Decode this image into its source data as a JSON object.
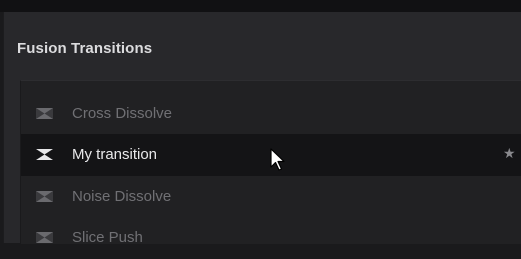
{
  "panel": {
    "title": "Fusion Transitions"
  },
  "transitions": [
    {
      "label": "Cross Dissolve",
      "selected": false
    },
    {
      "label": "My transition",
      "selected": true,
      "favorite_icon": "star-icon"
    },
    {
      "label": "Noise Dissolve",
      "selected": false
    },
    {
      "label": "Slice Push",
      "selected": false
    }
  ],
  "icons": {
    "transition": "transition-icon",
    "cursor": "pointer-cursor-icon"
  },
  "colors": {
    "panel_bg": "#28282b",
    "list_bg": "#212123",
    "selected_bg": "#141416",
    "text_dim": "#707074",
    "text_bright": "#e8e8ea"
  }
}
